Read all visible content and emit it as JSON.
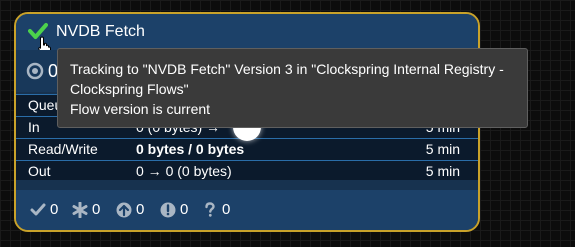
{
  "process_group": {
    "name": "NVDB Fetch",
    "version_state_icon": "check-icon",
    "accent_color": "#c9a22a"
  },
  "controller": {
    "icon": "ring-icon",
    "count": "0"
  },
  "stats": [
    {
      "label": "Queued",
      "value": "",
      "time": ""
    },
    {
      "label": "In",
      "value": "0 (0 bytes) →",
      "time": "5 min"
    },
    {
      "label": "Read/Write",
      "value": "0 bytes / 0 bytes",
      "time": "5 min"
    },
    {
      "label": "Out",
      "value": "0 → 0 (0 bytes)",
      "time": "5 min"
    }
  ],
  "footer": {
    "up_to_date": "0",
    "locally_modified": "0",
    "stale": "0",
    "locally_modified_and_stale": "0",
    "sync_failure": "0"
  },
  "tooltip": {
    "line1": "Tracking to \"NVDB Fetch\" Version 3 in \"Clockspring Internal Registry -",
    "line2": "Clockspring Flows\"",
    "line3": "Flow version is current"
  }
}
